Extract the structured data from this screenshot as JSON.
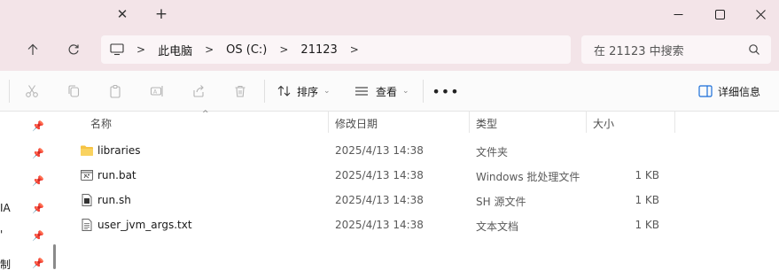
{
  "titlebar": {
    "tab_close_glyph": "✕",
    "new_tab_glyph": "+"
  },
  "address": {
    "segments": [
      "此电脑",
      "OS (C:)",
      "21123"
    ],
    "search_placeholder": "在 21123 中搜索"
  },
  "toolbar": {
    "sort_label": "排序",
    "view_label": "查看",
    "more_label": "•••",
    "details_label": "详细信息"
  },
  "navpane": {
    "labels": [
      "IA",
      "'",
      "制"
    ]
  },
  "columns": {
    "name": "名称",
    "modified": "修改日期",
    "type": "类型",
    "size": "大小"
  },
  "files": [
    {
      "name": "libraries",
      "modified": "2025/4/13 14:38",
      "type": "文件夹",
      "size": "",
      "icon": "folder-icon"
    },
    {
      "name": "run.bat",
      "modified": "2025/4/13 14:38",
      "type": "Windows 批处理文件",
      "size": "1 KB",
      "icon": "batch-file-icon"
    },
    {
      "name": "run.sh",
      "modified": "2025/4/13 14:38",
      "type": "SH 源文件",
      "size": "1 KB",
      "icon": "shell-file-icon"
    },
    {
      "name": "user_jvm_args.txt",
      "modified": "2025/4/13 14:38",
      "type": "文本文档",
      "size": "1 KB",
      "icon": "text-file-icon"
    }
  ],
  "colors": {
    "titlebar_bg": "#f3e4e8",
    "folder": "#f6c343",
    "accent": "#1a6ed8"
  }
}
